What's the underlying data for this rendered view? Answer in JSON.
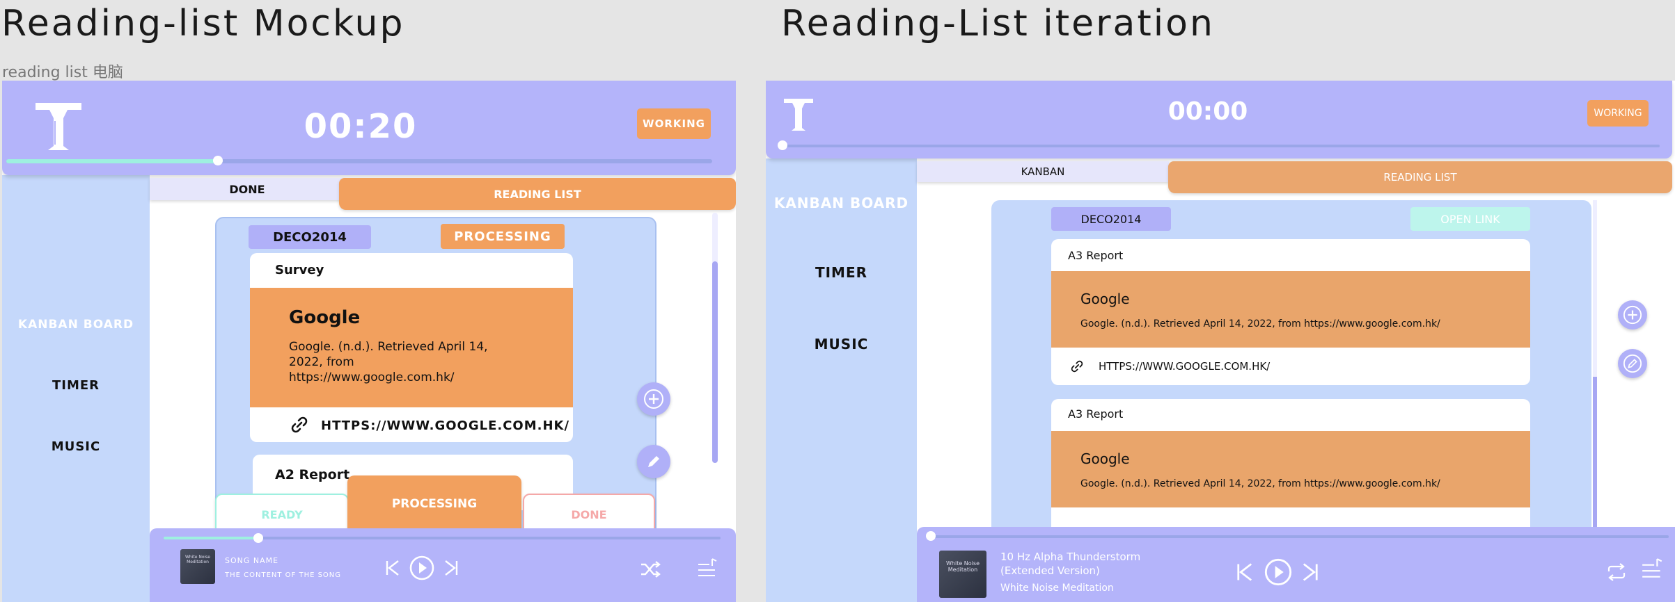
{
  "frames": {
    "left_title": "Reading-list Mockup",
    "left_subtitle": "reading list 电脑",
    "right_title": "Reading-List iteration"
  },
  "mockup": {
    "timer": "00:20",
    "status": "WORKING",
    "progress": 0.3,
    "tabs": {
      "done": "DONE",
      "reading": "READING LIST"
    },
    "nav": [
      "KANBAN BOARD",
      "TIMER",
      "MUSIC"
    ],
    "course": "DECO2014",
    "state": "PROCESSING",
    "card1": {
      "header": "Survey",
      "title": "Google",
      "citation": "Google. (n.d.). Retrieved April 14, 2022, from https://www.google.com.hk/",
      "link": "HTTPS://WWW.GOOGLE.COM.HK/"
    },
    "card2": {
      "header": "A2 Report"
    },
    "bottom_tabs": {
      "ready": "READY",
      "processing": "PROCESSING",
      "done": "DONE"
    },
    "player": {
      "song": "SONG NAME",
      "content": "THE CONTENT OF THE SONG",
      "album": "White Noise Meditation",
      "progress": 0.17
    }
  },
  "iteration": {
    "timer": "00:00",
    "status": "WORKING",
    "progress": 0.0,
    "tabs": {
      "kanban": "KANBAN",
      "reading": "READING LIST"
    },
    "nav": [
      "KANBAN BOARD",
      "TIMER",
      "MUSIC"
    ],
    "course": "DECO2014",
    "open_link": "OPEN LINK",
    "card1": {
      "header": "A3 Report",
      "title": "Google",
      "citation": "Google. (n.d.). Retrieved April 14, 2022, from https://www.google.com.hk/",
      "link": "HTTPS://WWW.GOOGLE.COM.HK/"
    },
    "card2": {
      "header": "A3 Report",
      "title": "Google",
      "citation": "Google. (n.d.). Retrieved April 14, 2022, from https://www.google.com.hk/"
    },
    "player": {
      "song_line1": "10 Hz Alpha Thunderstorm",
      "song_line2": "(Extended Version)",
      "artist": "White Noise Meditation",
      "album": "White Noise Meditation",
      "progress": 0.0
    }
  },
  "colors": {
    "purple": "#b4b4fa",
    "blue": "#c5d8fb",
    "orange": "#f2a05e",
    "mint": "#9ef0e0",
    "pink": "#f5a8a8"
  }
}
